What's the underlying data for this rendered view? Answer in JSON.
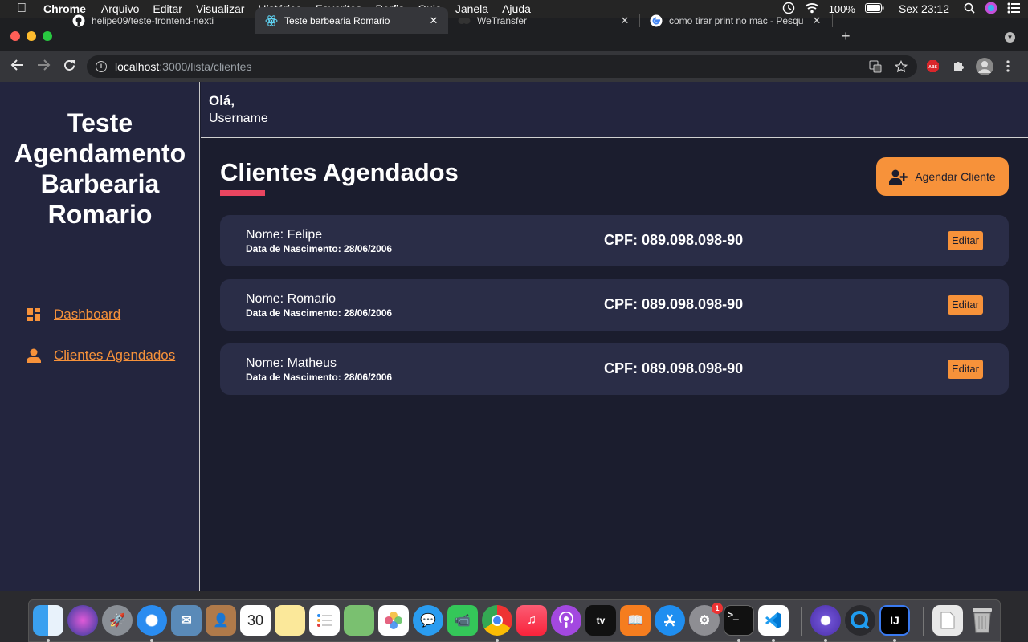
{
  "menubar": {
    "app": "Chrome",
    "items": [
      "Arquivo",
      "Editar",
      "Visualizar",
      "Histórico",
      "Favoritos",
      "Perfis",
      "Guia",
      "Janela",
      "Ajuda"
    ],
    "battery": "100%",
    "clock": "Sex 23:12"
  },
  "tabs": [
    {
      "title": "helipe09/teste-frontend-nexti",
      "icon": "github-icon"
    },
    {
      "title": "Teste barbearia Romario",
      "icon": "react-icon"
    },
    {
      "title": "WeTransfer",
      "icon": "wetransfer-icon"
    },
    {
      "title": "como tirar print no mac - Pesqu",
      "icon": "google-icon"
    }
  ],
  "address": {
    "host": "localhost",
    "path": ":3000/lista/clientes"
  },
  "sidebar": {
    "brand": "Teste Agendamento Barbearia Romario",
    "items": [
      {
        "label": "Dashboard",
        "icon": "dashboard-icon"
      },
      {
        "label": "Clientes Agendados",
        "icon": "user-icon"
      }
    ]
  },
  "header": {
    "greeting": "Olá,",
    "username": "Username"
  },
  "main": {
    "title": "Clientes Agendados",
    "add_button": "Agendar Cliente",
    "clients": [
      {
        "name": "Nome: Felipe",
        "dob": "Data de Nascimento: 28/06/2006",
        "cpf": "CPF: 089.098.098-90",
        "edit": "Editar"
      },
      {
        "name": "Nome: Romario",
        "dob": "Data de Nascimento: 28/06/2006",
        "cpf": "CPF: 089.098.098-90",
        "edit": "Editar"
      },
      {
        "name": "Nome: Matheus",
        "dob": "Data de Nascimento: 28/06/2006",
        "cpf": "CPF: 089.098.098-90",
        "edit": "Editar"
      }
    ]
  },
  "dock": {
    "calendar_day": "30",
    "settings_badge": "1",
    "terminal": ">_",
    "intellij": "IJ",
    "tv": "tv"
  },
  "colors": {
    "accent": "#f7923a",
    "underline": "#e94560",
    "sidebar_bg": "#23253e",
    "main_bg": "#1b1d2e",
    "card_bg": "#2a2d47"
  }
}
